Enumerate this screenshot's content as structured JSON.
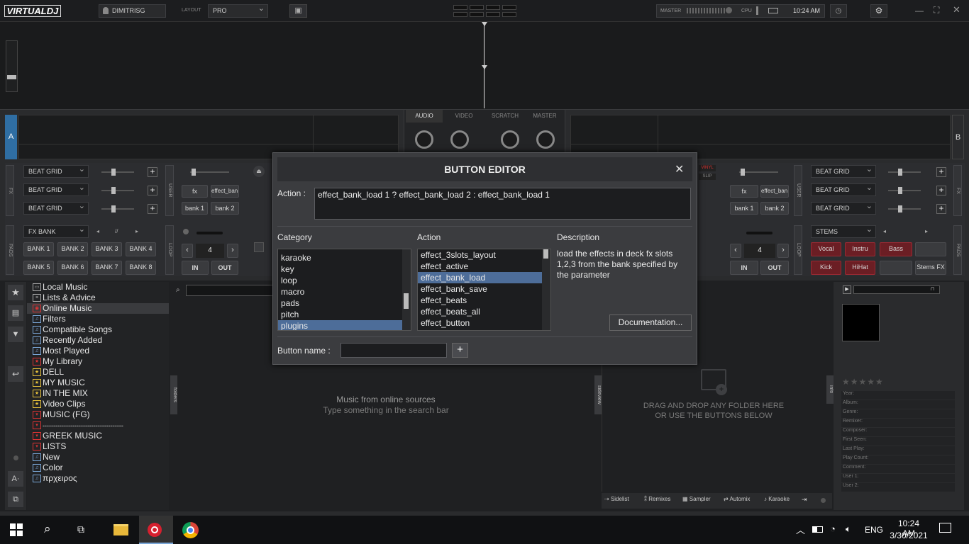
{
  "app": {
    "logo": "VIRTUALDJ",
    "user": "DIMITRISG",
    "layout_label": "LAYOUT",
    "layout_value": "PRO",
    "master_label": "MASTER",
    "cpu_label": "CPU",
    "time": "10:24 AM"
  },
  "deck_a": {
    "letter": "A",
    "fx_label": "FX",
    "beat_grid": [
      "BEAT GRID",
      "BEAT GRID",
      "BEAT GRID"
    ],
    "user_label": "USER",
    "fx_btn": "fx",
    "fx_bank_btn": "effect_ban...",
    "bank1": "bank 1",
    "bank2": "bank 2",
    "fx_bank": "FX BANK",
    "pads_label": "PADS",
    "banks": [
      "BANK 1",
      "BANK 2",
      "BANK 3",
      "BANK 4",
      "BANK 5",
      "BANK 6",
      "BANK 7",
      "BANK 8"
    ],
    "loop_label": "LOOP",
    "loop_value": "4",
    "in": "IN",
    "out": "OUT"
  },
  "deck_b": {
    "letter": "B",
    "vinyl": "VINYL",
    "slip": "SLIP",
    "fx_btn": "fx",
    "fx_bank_btn": "effect_ban...",
    "bank1": "bank 1",
    "bank2": "bank 2",
    "beat_grid": [
      "BEAT GRID",
      "BEAT GRID",
      "BEAT GRID"
    ],
    "user_label": "USER",
    "fx_label": "FX",
    "stems": "STEMS",
    "stem_pads": [
      "Vocal",
      "Instru",
      "Bass",
      "Kick",
      "HiHat",
      "Stems FX"
    ],
    "loop_label": "LOOP",
    "loop_value": "4",
    "in": "IN",
    "out": "OUT",
    "pads_label": "PADS"
  },
  "mixer_tabs": [
    "AUDIO",
    "VIDEO",
    "SCRATCH",
    "MASTER"
  ],
  "browser": {
    "tree": [
      {
        "label": "Local Music",
        "icon": "computer"
      },
      {
        "label": "Lists & Advice",
        "icon": "list"
      },
      {
        "label": "Online Music",
        "icon": "online",
        "selected": true
      },
      {
        "label": "Filters",
        "icon": "filter"
      },
      {
        "label": "Compatible Songs",
        "icon": "filter"
      },
      {
        "label": "Recently Added",
        "icon": "filter"
      },
      {
        "label": "Most Played",
        "icon": "filter"
      },
      {
        "label": "My Library",
        "icon": "star"
      },
      {
        "label": "DELL",
        "icon": "star"
      },
      {
        "label": "MY MUSIC",
        "icon": "star"
      },
      {
        "label": "IN THE MIX",
        "icon": "star"
      },
      {
        "label": "Video Clips",
        "icon": "star"
      },
      {
        "label": "MUSIC (FG)",
        "icon": "red"
      },
      {
        "label": "--------------------------------------",
        "icon": "red"
      },
      {
        "label": "GREEK MUSIC",
        "icon": "red"
      },
      {
        "label": "LISTS",
        "icon": "red"
      },
      {
        "label": "New",
        "icon": "filter"
      },
      {
        "label": "Color",
        "icon": "filter"
      },
      {
        "label": "πρχειρος",
        "icon": "filter"
      }
    ],
    "folders_tab": "folders",
    "online_title": "Music from online sources",
    "online_sub": "Type something in the search bar",
    "sideview_tab": "sideview",
    "drag_title": "DRAG AND DROP ANY FOLDER HERE",
    "drag_sub": "OR USE THE BUTTONS BELOW",
    "info_tab": "info",
    "bottom_tabs": [
      "Sidelist",
      "Remixes",
      "Sampler",
      "Automix",
      "Karaoke"
    ],
    "info_fields": [
      "Year:",
      "Album:",
      "Genre:",
      "Remixer:",
      "Composer:",
      "First Seen:",
      "Last Play:",
      "Play Count:",
      "Comment:",
      "User 1:",
      "User 2:"
    ]
  },
  "dialog": {
    "title": "BUTTON EDITOR",
    "action_label": "Action :",
    "action_value": "effect_bank_load 1 ? effect_bank_load 2 :  effect_bank_load 1",
    "category_header": "Category",
    "action_header": "Action",
    "description_header": "Description",
    "categories": [
      "karaoke",
      "key",
      "loop",
      "macro",
      "pads",
      "pitch",
      "plugins"
    ],
    "actions": [
      "effect_3slots_layout",
      "effect_active",
      "effect_bank_load",
      "effect_bank_save",
      "effect_beats",
      "effect_beats_all",
      "effect_button"
    ],
    "description": "load the effects in deck fx slots 1,2,3 from the bank specified by the parameter",
    "doc_button": "Documentation...",
    "button_name_label": "Button name :",
    "button_name_value": "",
    "plus": "+"
  },
  "taskbar": {
    "lang": "ENG",
    "time": "10:24 AM",
    "date": "3/30/2021"
  }
}
